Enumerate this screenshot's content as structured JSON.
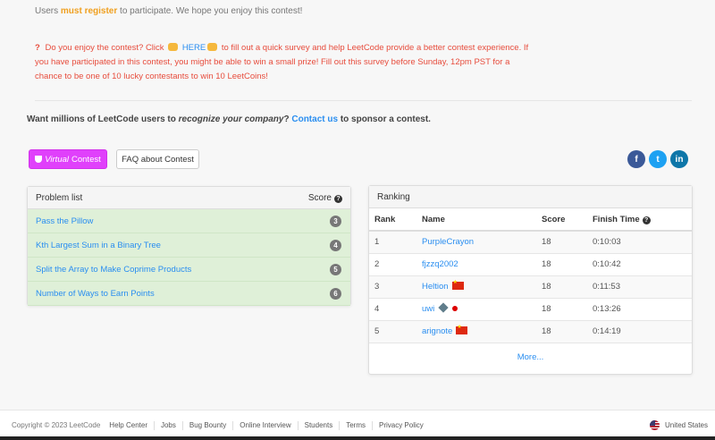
{
  "intro": {
    "prefix": "Users",
    "register": "must register",
    "suffix": "to participate. We hope you enjoy this contest!"
  },
  "survey": {
    "qmark": "?",
    "part1": "Do you enjoy the contest? Click",
    "here": "HERE",
    "part2": "to fill out a quick survey and help LeetCode provide a better contest experience. If you have participated in this contest, you might be able to win a small prize! Fill out this survey before Sunday, 12pm PST for a chance to be one of 10 lucky contestants to win 10 LeetCoins!"
  },
  "sponsor": {
    "part1": "Want millions of LeetCode users to",
    "emphasis": "recognize your company",
    "part2": "?",
    "contact": "Contact us",
    "part3": "to sponsor a contest."
  },
  "buttons": {
    "virtual_italic": "Virtual",
    "virtual_rest": "Contest",
    "faq": "FAQ about Contest"
  },
  "social": {
    "facebook": "f",
    "twitter": "t",
    "linkedin": "in"
  },
  "problems": {
    "header": "Problem list",
    "score_header": "Score",
    "items": [
      {
        "title": "Pass the Pillow",
        "score": "3"
      },
      {
        "title": "Kth Largest Sum in a Binary Tree",
        "score": "4"
      },
      {
        "title": "Split the Array to Make Coprime Products",
        "score": "5"
      },
      {
        "title": "Number of Ways to Earn Points",
        "score": "6"
      }
    ]
  },
  "ranking": {
    "header": "Ranking",
    "columns": {
      "rank": "Rank",
      "name": "Name",
      "score": "Score",
      "finish": "Finish Time"
    },
    "rows": [
      {
        "rank": "1",
        "name": "PurpleCrayon",
        "score": "18",
        "finish": "0:10:03"
      },
      {
        "rank": "2",
        "name": "fjzzq2002",
        "score": "18",
        "finish": "0:10:42"
      },
      {
        "rank": "3",
        "name": "Heltion",
        "score": "18",
        "finish": "0:11:53"
      },
      {
        "rank": "4",
        "name": "uwi",
        "score": "18",
        "finish": "0:13:26"
      },
      {
        "rank": "5",
        "name": "arignote",
        "score": "18",
        "finish": "0:14:19"
      }
    ],
    "more": "More..."
  },
  "footer": {
    "copyright": "Copyright © 2023 LeetCode",
    "links": [
      "Help Center",
      "Jobs",
      "Bug Bounty",
      "Online Interview",
      "Students",
      "Terms",
      "Privacy Policy"
    ],
    "region": "United States"
  }
}
